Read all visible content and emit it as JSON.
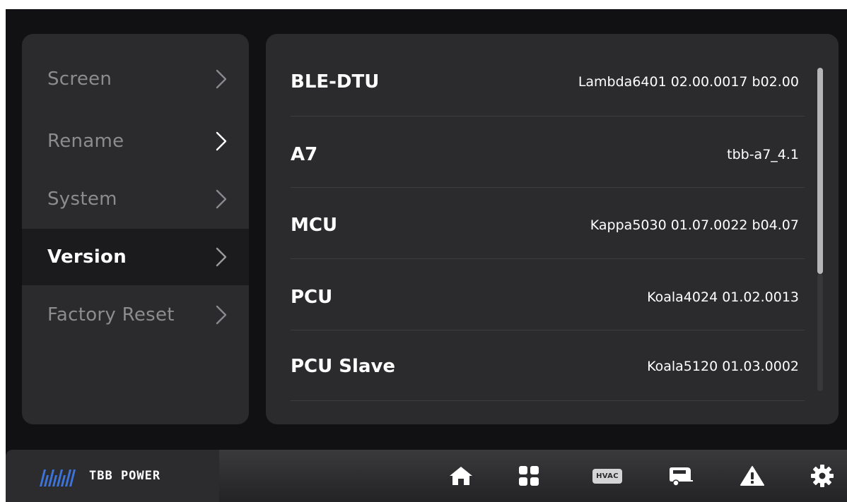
{
  "sidebar": {
    "items": [
      {
        "label": "Screen"
      },
      {
        "label": "Rename"
      },
      {
        "label": "System"
      },
      {
        "label": "Version"
      },
      {
        "label": "Factory Reset"
      }
    ],
    "active_index": 3
  },
  "versions": {
    "rows": [
      {
        "name": "BLE-DTU",
        "value": "Lambda6401 02.00.0017 b02.00"
      },
      {
        "name": "A7",
        "value": "tbb-a7_4.1"
      },
      {
        "name": "MCU",
        "value": "Kappa5030 01.07.0022 b04.07"
      },
      {
        "name": "PCU",
        "value": "Koala4024 01.02.0013"
      },
      {
        "name": "PCU Slave",
        "value": "Koala5120 01.03.0002"
      }
    ]
  },
  "bottom_nav": {
    "brand": "TBB POWER",
    "hvac_label": "HVAC",
    "icons": [
      "home-icon",
      "dashboard-grid-icon",
      "hvac-icon",
      "rv-camper-icon",
      "warning-icon",
      "settings-gear-icon"
    ]
  },
  "colors": {
    "background": "#111113",
    "panel": "#2b2b2d",
    "active_item": "#1b1b1d",
    "text_primary": "#ffffff",
    "text_muted": "#8c8c8f",
    "brand_blue": "#3d74d9"
  }
}
